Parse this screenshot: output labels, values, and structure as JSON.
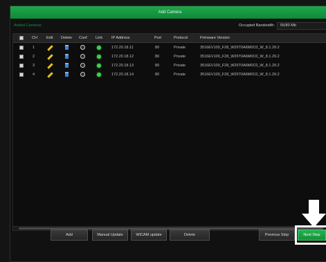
{
  "window": {
    "title": "Add Camera"
  },
  "section": {
    "label": "Added Cameras"
  },
  "bandwidth": {
    "label": "Occupied Bandwidth:",
    "value": "55/80 Mb"
  },
  "table": {
    "columns": [
      "CH",
      "Edit",
      "Delete",
      "Conf",
      "Link",
      "IP Address",
      "Port",
      "Protocol",
      "Firmware Version"
    ],
    "rows": [
      {
        "ch": "1",
        "ip": "172.20.18.11",
        "port": "80",
        "protocol": "Private",
        "firmware": "3516EV100_F28_W26T0A6M0C0_W_8.1.29.2"
      },
      {
        "ch": "2",
        "ip": "172.20.18.12",
        "port": "80",
        "protocol": "Private",
        "firmware": "3516EV100_F28_W26T0A6M0C0_W_8.1.29.2"
      },
      {
        "ch": "3",
        "ip": "172.20.18.13",
        "port": "80",
        "protocol": "Private",
        "firmware": "3516EV100_F28_W26T0A6M0C0_W_8.1.29.2"
      },
      {
        "ch": "4",
        "ip": "172.20.18.14",
        "port": "80",
        "protocol": "Private",
        "firmware": "3516EV100_F28_W26T0A6M0C0_W_8.1.29.2"
      }
    ]
  },
  "buttons": {
    "add": "Add",
    "manual_update": "Manual Update",
    "wicam_update": "WICAM update",
    "delete": "Delete",
    "previous_step": "Previous Step",
    "next_step": "Next Step"
  },
  "colors": {
    "accent": "#14903b",
    "link_online": "#3fd14a",
    "edit_icon": "#e7c21a",
    "delete_icon": "#3a86d6"
  },
  "icons": {
    "edit": "pencil-icon",
    "delete": "trash-icon",
    "conf": "config-icon",
    "link": "link-status-icon",
    "annotation": "arrow-down-icon"
  }
}
